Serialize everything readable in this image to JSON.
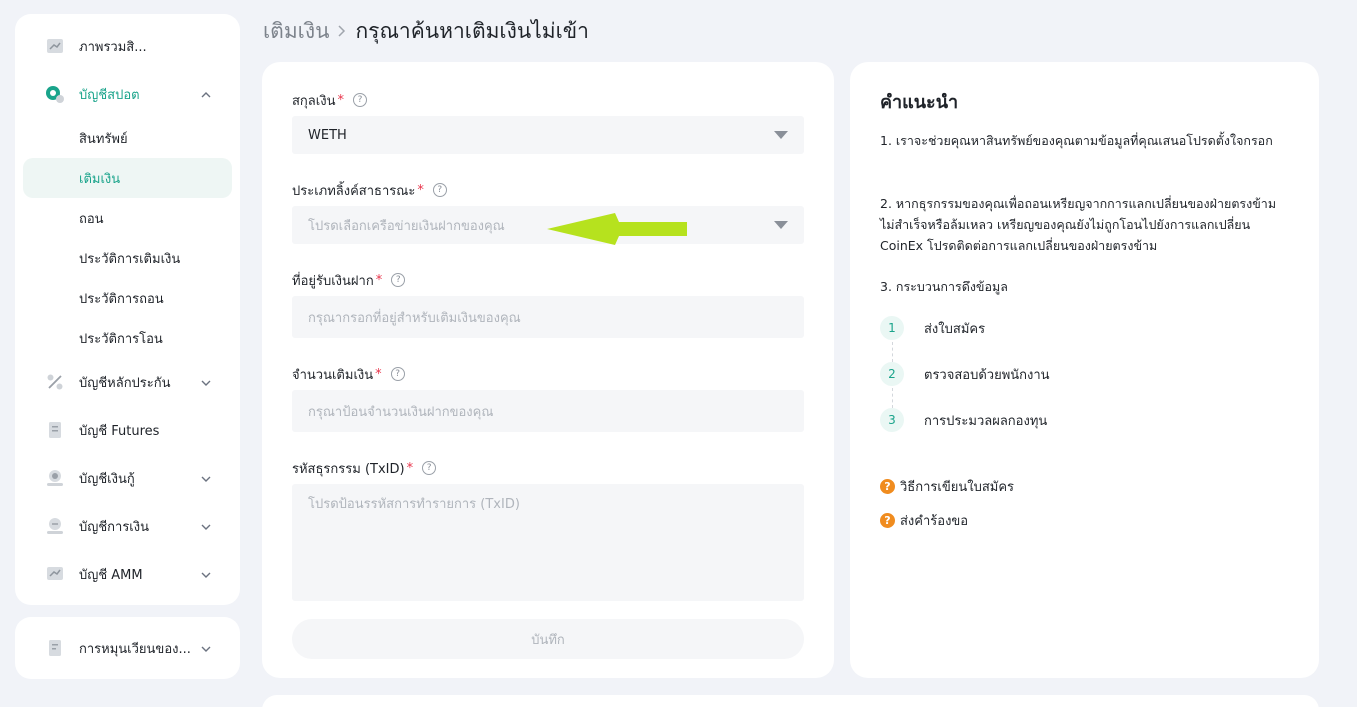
{
  "sidebar": {
    "items": [
      {
        "label": "ภาพรวมสิ...",
        "icon": "chart-overview-icon",
        "chevron": ""
      },
      {
        "label": "บัญชีสปอต",
        "icon": "spot-coin-icon",
        "chevron": "up"
      },
      {
        "label": "บัญชีหลักประกัน",
        "icon": "percent-icon",
        "chevron": "down"
      },
      {
        "label": "บัญชี Futures",
        "icon": "futures-doc-icon",
        "chevron": ""
      },
      {
        "label": "บัญชีเงินกู้",
        "icon": "loan-icon",
        "chevron": "down"
      },
      {
        "label": "บัญชีการเงิน",
        "icon": "finance-icon",
        "chevron": "down"
      },
      {
        "label": "บัญชี AMM",
        "icon": "amm-icon",
        "chevron": "down"
      }
    ],
    "sub_items": [
      {
        "label": "สินทรัพย์"
      },
      {
        "label": "เติมเงิน"
      },
      {
        "label": "ถอน"
      },
      {
        "label": "ประวัติการเติมเงิน"
      },
      {
        "label": "ประวัติการถอน"
      },
      {
        "label": "ประวัติการโอน"
      }
    ],
    "extra": {
      "label": "การหมุนเวียนของ...",
      "icon": "circulation-doc-icon"
    }
  },
  "breadcrumb": {
    "parent": "เติมเงิน",
    "current": "กรุณาค้นหาเติมเงินไม่เข้า"
  },
  "form": {
    "currency": {
      "label": "สกุลเงิน",
      "value": "WETH"
    },
    "chain": {
      "label": "ประเภทลิ้งค์สาธารณะ",
      "placeholder": "โปรดเลือกเครือข่ายเงินฝากของคุณ"
    },
    "address": {
      "label": "ที่อยู่รับเงินฝาก",
      "placeholder": "กรุณากรอกที่อยู่สำหรับเติมเงินของคุณ"
    },
    "amount": {
      "label": "จำนวนเติมเงิน",
      "placeholder": "กรุณาป้อนจำนวนเงินฝากของคุณ"
    },
    "txid": {
      "label": "รหัสธุรกรรม (TxID)",
      "placeholder": "โปรดป้อนรรหัสการทำรายการ (TxID)"
    },
    "required_mark": "*",
    "help_mark": "?",
    "save_label": "บันทึก"
  },
  "guide": {
    "title": "คำแนะนำ",
    "p1": "1. เราจะช่วยคุณหาสินทรัพย์ของคุณตามข้อมูลที่คุณเสนอโปรดตั้งใจกรอก",
    "p2": "2. หากธุรกรรมของคุณเพื่อถอนเหรียญจากการแลกเปลี่ยนของฝ่ายตรงข้ามไม่สำเร็จหรือล้มเหลว เหรียญของคุณยังไม่ถูกโอนไปยังการแลกเปลี่ยน CoinEx โปรดติดต่อการแลกเปลี่ยนของฝ่ายตรงข้าม",
    "p3": "3. กระบวนการดึงข้อมูล",
    "steps": [
      {
        "num": "1",
        "label": "ส่งใบสมัคร"
      },
      {
        "num": "2",
        "label": "ตรวจสอบด้วยพนักงาน"
      },
      {
        "num": "3",
        "label": "การประมวลผลกองทุน"
      }
    ],
    "links": [
      {
        "label": "วิธีการเขียนใบสมัคร"
      },
      {
        "label": "ส่งคำร้องขอ"
      }
    ],
    "link_icon": "?"
  },
  "colors": {
    "accent": "#1aa48b",
    "arrow": "#b6e21e",
    "warning": "#f08c1f",
    "required": "#e8334a"
  }
}
